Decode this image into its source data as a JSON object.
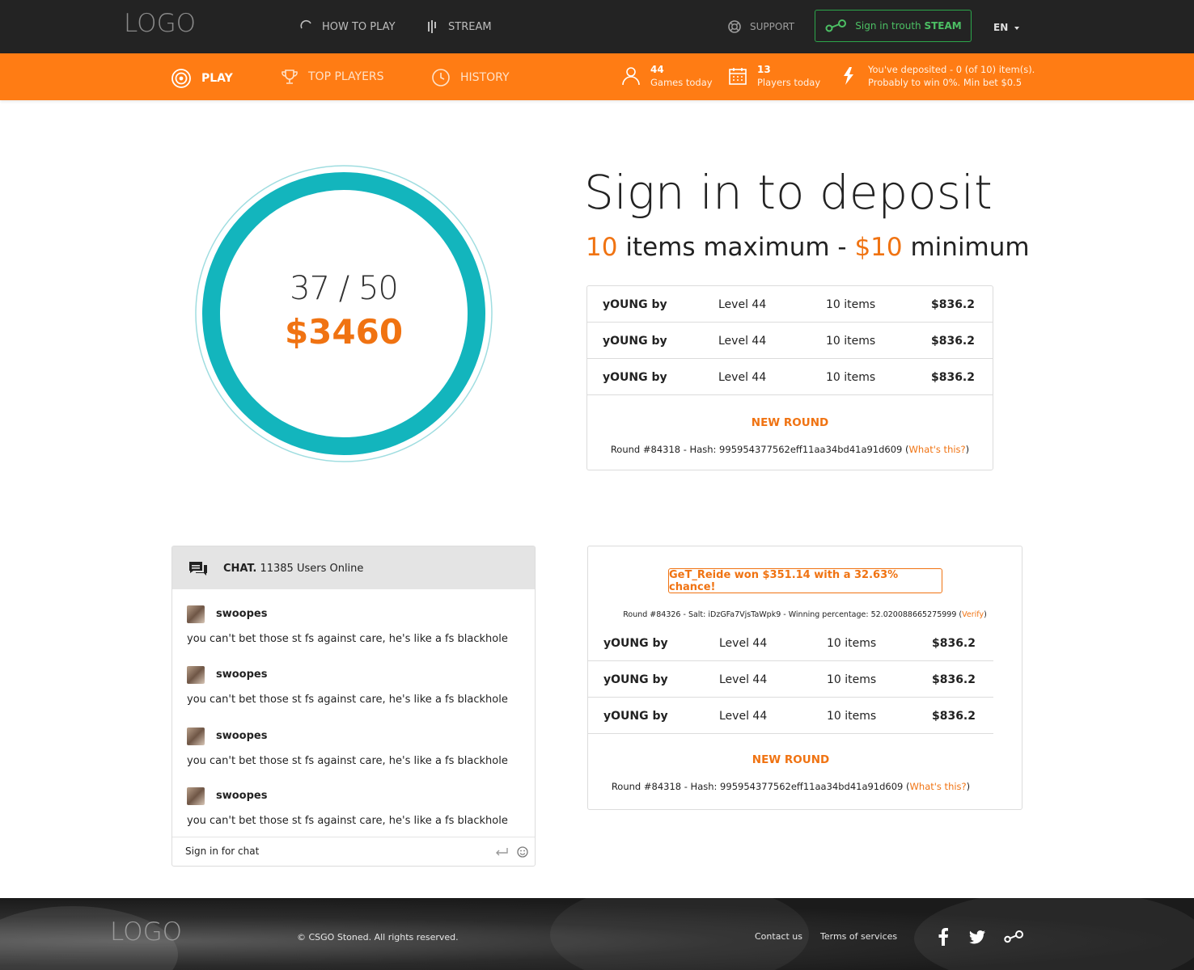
{
  "header": {
    "logo": "LOGO",
    "nav": [
      {
        "label": "HOW TO PLAY",
        "icon": "spinner-icon"
      },
      {
        "label": "STREAM",
        "icon": "stream-icon"
      }
    ],
    "support_label": "SUPPORT",
    "signin": {
      "prefix": "Sign in trouth",
      "brand": "STEAM"
    },
    "language": "EN"
  },
  "subnav": {
    "items": [
      {
        "label": "PLAY",
        "icon": "target-icon",
        "active": true
      },
      {
        "label": "TOP PLAYERS",
        "icon": "trophy-icon",
        "active": false
      },
      {
        "label": "HISTORY",
        "icon": "clock-icon",
        "active": false
      }
    ],
    "stats": {
      "games": {
        "value": "44",
        "label": "Games today"
      },
      "players": {
        "value": "13",
        "label": "Players today"
      },
      "deposit": {
        "line1": "You've deposited - 0 (of 10) item(s).",
        "line2": "Probably to win 0%. Min bet $0.5"
      }
    }
  },
  "jackpot": {
    "count": "37 / 50",
    "amount": "$3460",
    "ring_color": "#13b5bd"
  },
  "deposit": {
    "title": "Sign in to deposit",
    "items_max": "10",
    "items_text": "items maximum -",
    "min_value": "$10",
    "min_text": "minimum"
  },
  "current_round": {
    "rows": [
      {
        "name": "yOUNG by",
        "level": "Level 44",
        "items": "10 items",
        "price": "$836.2"
      },
      {
        "name": "yOUNG by",
        "level": "Level 44",
        "items": "10 items",
        "price": "$836.2"
      },
      {
        "name": "yOUNG by",
        "level": "Level 44",
        "items": "10 items",
        "price": "$836.2"
      }
    ],
    "new_round_label": "NEW ROUND",
    "hash_text": "Round #84318 - Hash: 995954377562eff11aa34bd41a91d609 (",
    "hash_link": "What's this?",
    "hash_close": ")"
  },
  "previous_round": {
    "winner": "GeT_Reide won $351.14 with a 32.63% chance!",
    "salt_text": "Round #84326 - Salt: iDzGFa7VjsTaWpk9 - Winning percentage: 52.020088665275999 (",
    "salt_link": "Verify",
    "salt_close": ")",
    "rows": [
      {
        "name": "yOUNG by",
        "level": "Level 44",
        "items": "10 items",
        "price": "$836.2"
      },
      {
        "name": "yOUNG by",
        "level": "Level 44",
        "items": "10 items",
        "price": "$836.2"
      },
      {
        "name": "yOUNG by",
        "level": "Level 44",
        "items": "10 items",
        "price": "$836.2"
      }
    ],
    "new_round_label": "NEW ROUND",
    "hash_text": "Round #84318 - Hash: 995954377562eff11aa34bd41a91d609 (",
    "hash_link": "What's this?",
    "hash_close": ")"
  },
  "chat": {
    "title": "CHAT.",
    "online": "11385 Users Online",
    "messages": [
      {
        "user": "swoopes",
        "text": "you can't bet those st fs against care, he's like a fs blackhole"
      },
      {
        "user": "swoopes",
        "text": "you can't bet those st fs against care, he's like a fs blackhole"
      },
      {
        "user": "swoopes",
        "text": "you can't bet those st fs against care, he's like a fs blackhole"
      },
      {
        "user": "swoopes",
        "text": "you can't bet those st fs against care, he's like a fs blackhole"
      }
    ],
    "input_placeholder": "Sign in for chat"
  },
  "footer": {
    "logo": "LOGO",
    "copyright": "© CSGO Stoned. All rights reserved.",
    "links": [
      "Contact us",
      "Terms of services"
    ],
    "social": [
      "facebook-icon",
      "twitter-icon",
      "steam-icon"
    ]
  },
  "colors": {
    "accent": "#f07312",
    "nav_orange": "#ff7c14",
    "teal": "#13b5bd",
    "steam_green": "#4cc064",
    "dark": "#232323"
  }
}
